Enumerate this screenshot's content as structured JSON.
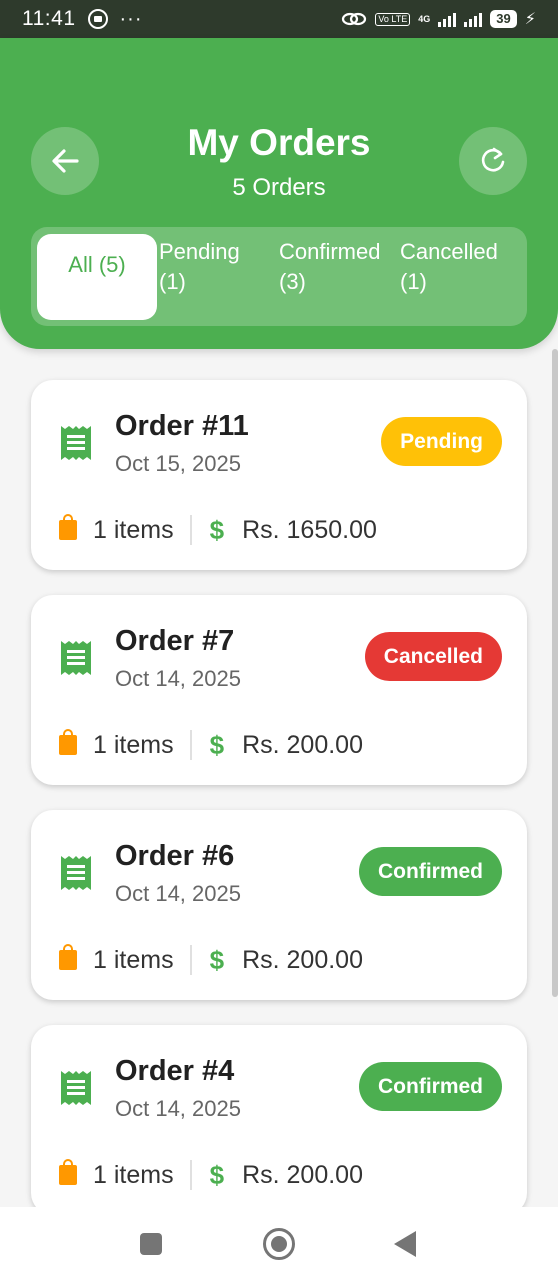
{
  "status_bar": {
    "time": "11:41",
    "dots": "···",
    "network": "4G",
    "volte": "Vo LTE",
    "battery": "39"
  },
  "header": {
    "title": "My Orders",
    "subtitle": "5 Orders",
    "back_icon": "arrow-left-icon",
    "refresh_icon": "refresh-icon",
    "accent_color": "#4caf50"
  },
  "tabs": [
    {
      "label": "All (5)",
      "active": true
    },
    {
      "label_line1": "Pending",
      "label_line2": "(1)"
    },
    {
      "label_line1": "Confirmed",
      "label_line2": "(3)"
    },
    {
      "label_line1": "Cancelled",
      "label_line2": "(1)"
    }
  ],
  "orders": [
    {
      "title": "Order #11",
      "date": "Oct 15, 2025",
      "status": "Pending",
      "status_color": "#ffc107",
      "items": "1 items",
      "amount": "Rs. 1650.00"
    },
    {
      "title": "Order #7",
      "date": "Oct 14, 2025",
      "status": "Cancelled",
      "status_color": "#e53935",
      "items": "1 items",
      "amount": "Rs. 200.00"
    },
    {
      "title": "Order #6",
      "date": "Oct 14, 2025",
      "status": "Confirmed",
      "status_color": "#4caf50",
      "items": "1 items",
      "amount": "Rs. 200.00"
    },
    {
      "title": "Order #4",
      "date": "Oct 14, 2025",
      "status": "Confirmed",
      "status_color": "#4caf50",
      "items": "1 items",
      "amount": "Rs. 200.00"
    }
  ],
  "symbols": {
    "dollar": "$"
  },
  "nav": {
    "recent_icon": "square-icon",
    "home_icon": "circle-icon",
    "back_icon": "triangle-back-icon"
  }
}
